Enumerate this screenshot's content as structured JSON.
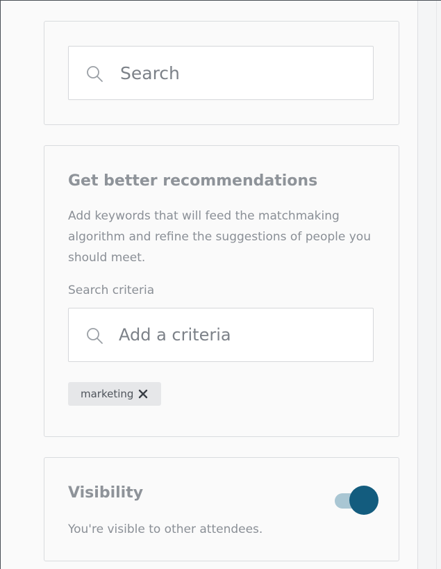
{
  "search": {
    "placeholder": "Search",
    "icon": "search-icon"
  },
  "recommendations": {
    "title": "Get better recommendations",
    "description": "Add keywords that will feed the matchmaking algorithm and refine the suggestions of people you should meet.",
    "criteria_label": "Search criteria",
    "criteria_placeholder": "Add a criteria",
    "criteria_icon": "search-icon",
    "tags": [
      {
        "label": "marketing",
        "remove_icon": "close-icon"
      }
    ]
  },
  "visibility": {
    "title": "Visibility",
    "description": "You're visible to other attendees.",
    "enabled": true
  },
  "colors": {
    "toggle_knob": "#135c7e",
    "toggle_track": "#a9c6d3",
    "tag_background": "#e6e7e9"
  }
}
